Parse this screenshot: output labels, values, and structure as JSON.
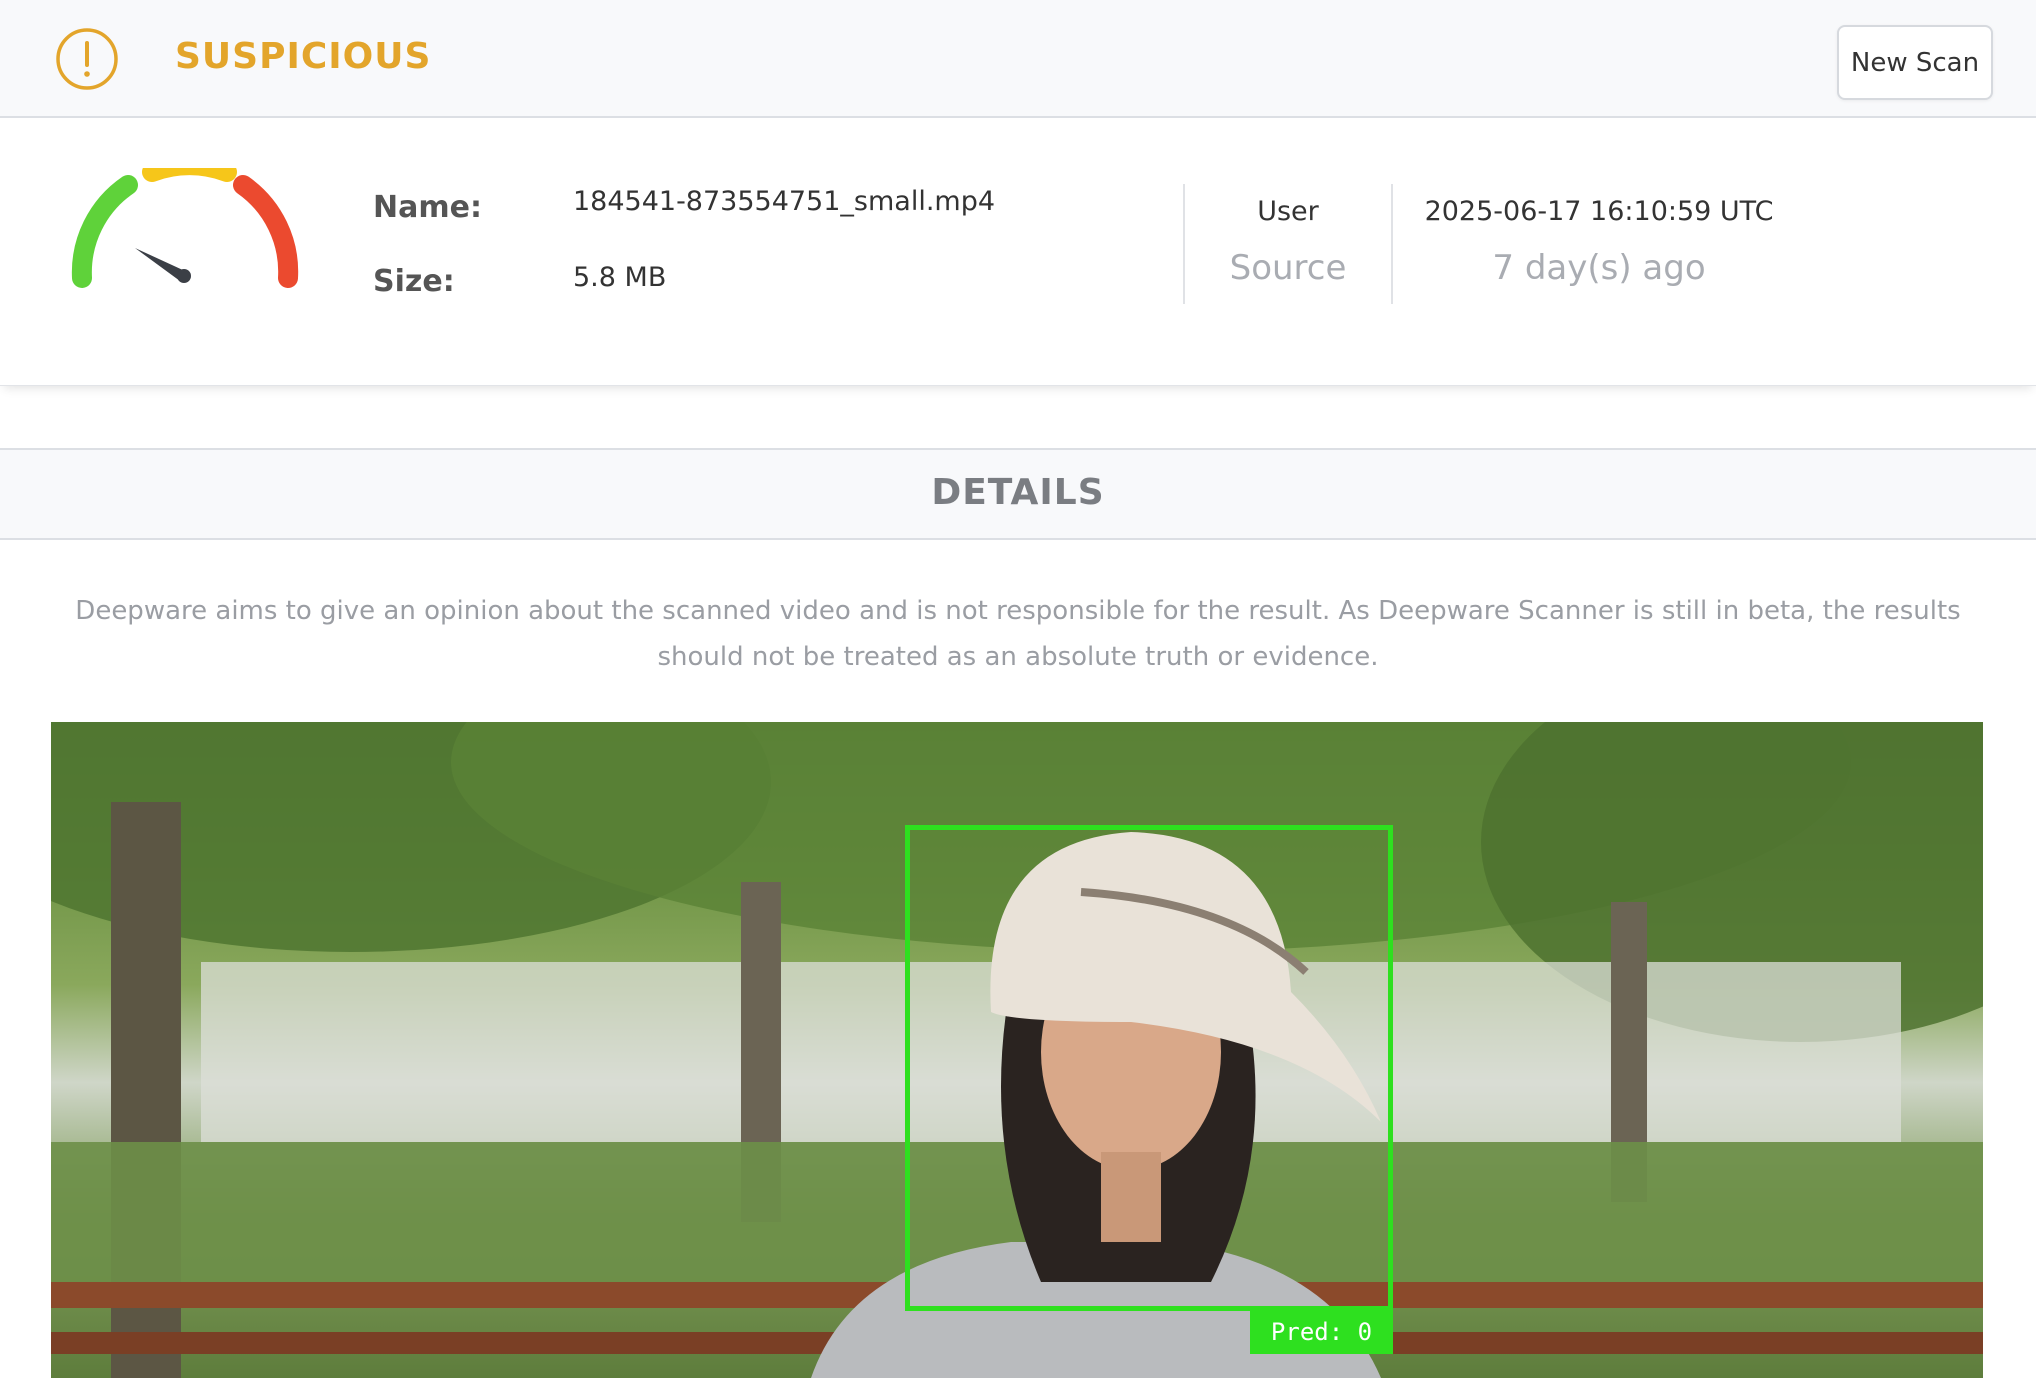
{
  "status": {
    "label": "SUSPICIOUS",
    "icon": "exclamation-circle-icon",
    "color": "#e3a52b"
  },
  "toolbar": {
    "new_scan_label": "New Scan"
  },
  "file": {
    "name_label": "Name:",
    "name_value": "184541-873554751_small.mp4",
    "size_label": "Size:",
    "size_value": "5.8 MB"
  },
  "source": {
    "value": "User",
    "label": "Source"
  },
  "scan_time": {
    "timestamp": "2025-06-17 16:10:59 UTC",
    "relative": "7 day(s) ago"
  },
  "gauge": {
    "icon": "risk-gauge-icon",
    "segment_colors": [
      "#5fd23a",
      "#f6c61a",
      "#eb4a2f"
    ],
    "needle_color": "#3b3f46"
  },
  "details": {
    "title": "DETAILS",
    "disclaimer": "Deepware aims to give an opinion about the scanned video and is not responsible for the result. As Deepware Scanner is still in beta, the results should not be treated as an absolute truth or evidence."
  },
  "video": {
    "prediction_label": "Pred: 0",
    "box_color": "#2ee01f"
  }
}
